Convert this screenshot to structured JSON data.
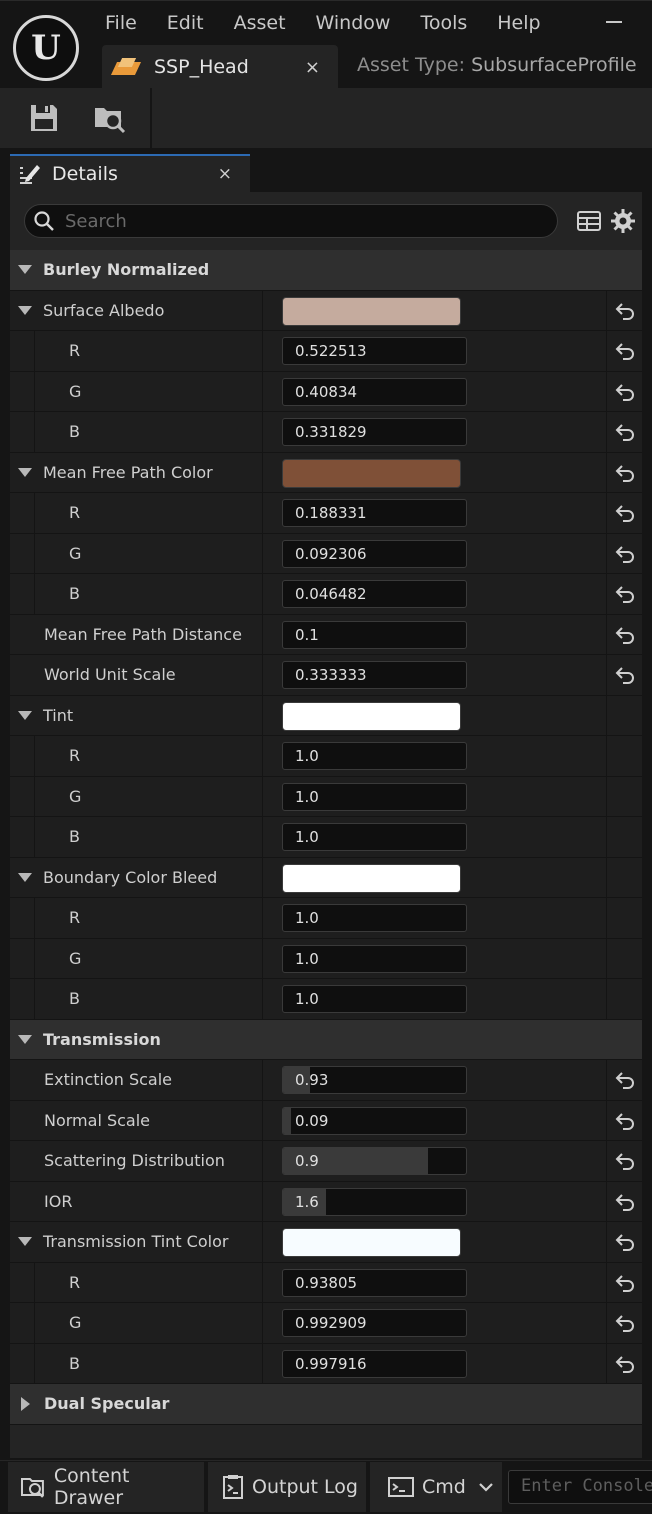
{
  "menu": [
    "File",
    "Edit",
    "Asset",
    "Window",
    "Tools",
    "Help"
  ],
  "logo_letter": "U",
  "document_tab": {
    "label": "SSP_Head",
    "close": "×"
  },
  "asset_type": {
    "label": "Asset Type:",
    "value": "SubsurfaceProfile"
  },
  "details_tab": {
    "label": "Details",
    "close": "×"
  },
  "search": {
    "placeholder": "Search"
  },
  "rows": [
    {
      "kind": "category",
      "label": "Burley Normalized",
      "expanded": true
    },
    {
      "kind": "color",
      "label": "Surface Albedo",
      "color": "#c5ab9e",
      "expanded": true,
      "reset": true
    },
    {
      "kind": "sub",
      "label": "R",
      "value": "0.522513",
      "reset": true
    },
    {
      "kind": "sub",
      "label": "G",
      "value": "0.40834",
      "reset": true
    },
    {
      "kind": "sub",
      "label": "B",
      "value": "0.331829",
      "reset": true
    },
    {
      "kind": "color",
      "label": "Mean Free Path Color",
      "color": "#7f5037",
      "expanded": true,
      "reset": true
    },
    {
      "kind": "sub",
      "label": "R",
      "value": "0.188331",
      "reset": true
    },
    {
      "kind": "sub",
      "label": "G",
      "value": "0.092306",
      "reset": true
    },
    {
      "kind": "sub",
      "label": "B",
      "value": "0.046482",
      "reset": true
    },
    {
      "kind": "plain",
      "label": "Mean Free Path Distance",
      "value": "0.1",
      "reset": true
    },
    {
      "kind": "plain",
      "label": "World Unit Scale",
      "value": "0.333333",
      "reset": true
    },
    {
      "kind": "color",
      "label": "Tint",
      "color": "#ffffff",
      "expanded": true,
      "reset": false
    },
    {
      "kind": "sub",
      "label": "R",
      "value": "1.0",
      "reset": false
    },
    {
      "kind": "sub",
      "label": "G",
      "value": "1.0",
      "reset": false
    },
    {
      "kind": "sub",
      "label": "B",
      "value": "1.0",
      "reset": false
    },
    {
      "kind": "color",
      "label": "Boundary Color Bleed",
      "color": "#ffffff",
      "expanded": true,
      "reset": false
    },
    {
      "kind": "sub",
      "label": "R",
      "value": "1.0",
      "reset": false
    },
    {
      "kind": "sub",
      "label": "G",
      "value": "1.0",
      "reset": false
    },
    {
      "kind": "sub",
      "label": "B",
      "value": "1.0",
      "reset": false
    },
    {
      "kind": "category",
      "label": "Transmission",
      "expanded": true
    },
    {
      "kind": "plain",
      "label": "Extinction Scale",
      "value": "0.93",
      "slider": 0.17,
      "reset": true
    },
    {
      "kind": "plain",
      "label": "Normal Scale",
      "value": "0.09",
      "slider": 0.05,
      "reset": true
    },
    {
      "kind": "plain",
      "label": "Scattering Distribution",
      "value": "0.9",
      "slider": 0.9,
      "reset": true
    },
    {
      "kind": "plain",
      "label": "IOR",
      "value": "1.6",
      "slider": 0.27,
      "reset": true
    },
    {
      "kind": "color",
      "label": "Transmission Tint Color",
      "color": "#f7fcff",
      "expanded": true,
      "reset": true
    },
    {
      "kind": "sub",
      "label": "R",
      "value": "0.93805",
      "reset": true
    },
    {
      "kind": "sub",
      "label": "G",
      "value": "0.992909",
      "reset": true
    },
    {
      "kind": "sub",
      "label": "B",
      "value": "0.997916",
      "reset": true
    },
    {
      "kind": "category",
      "label": "Dual Specular",
      "expanded": false
    }
  ],
  "bottom": {
    "content_drawer": "Content Drawer",
    "output_log": "Output Log",
    "cmd": "Cmd",
    "console_placeholder": "Enter Console Command"
  }
}
